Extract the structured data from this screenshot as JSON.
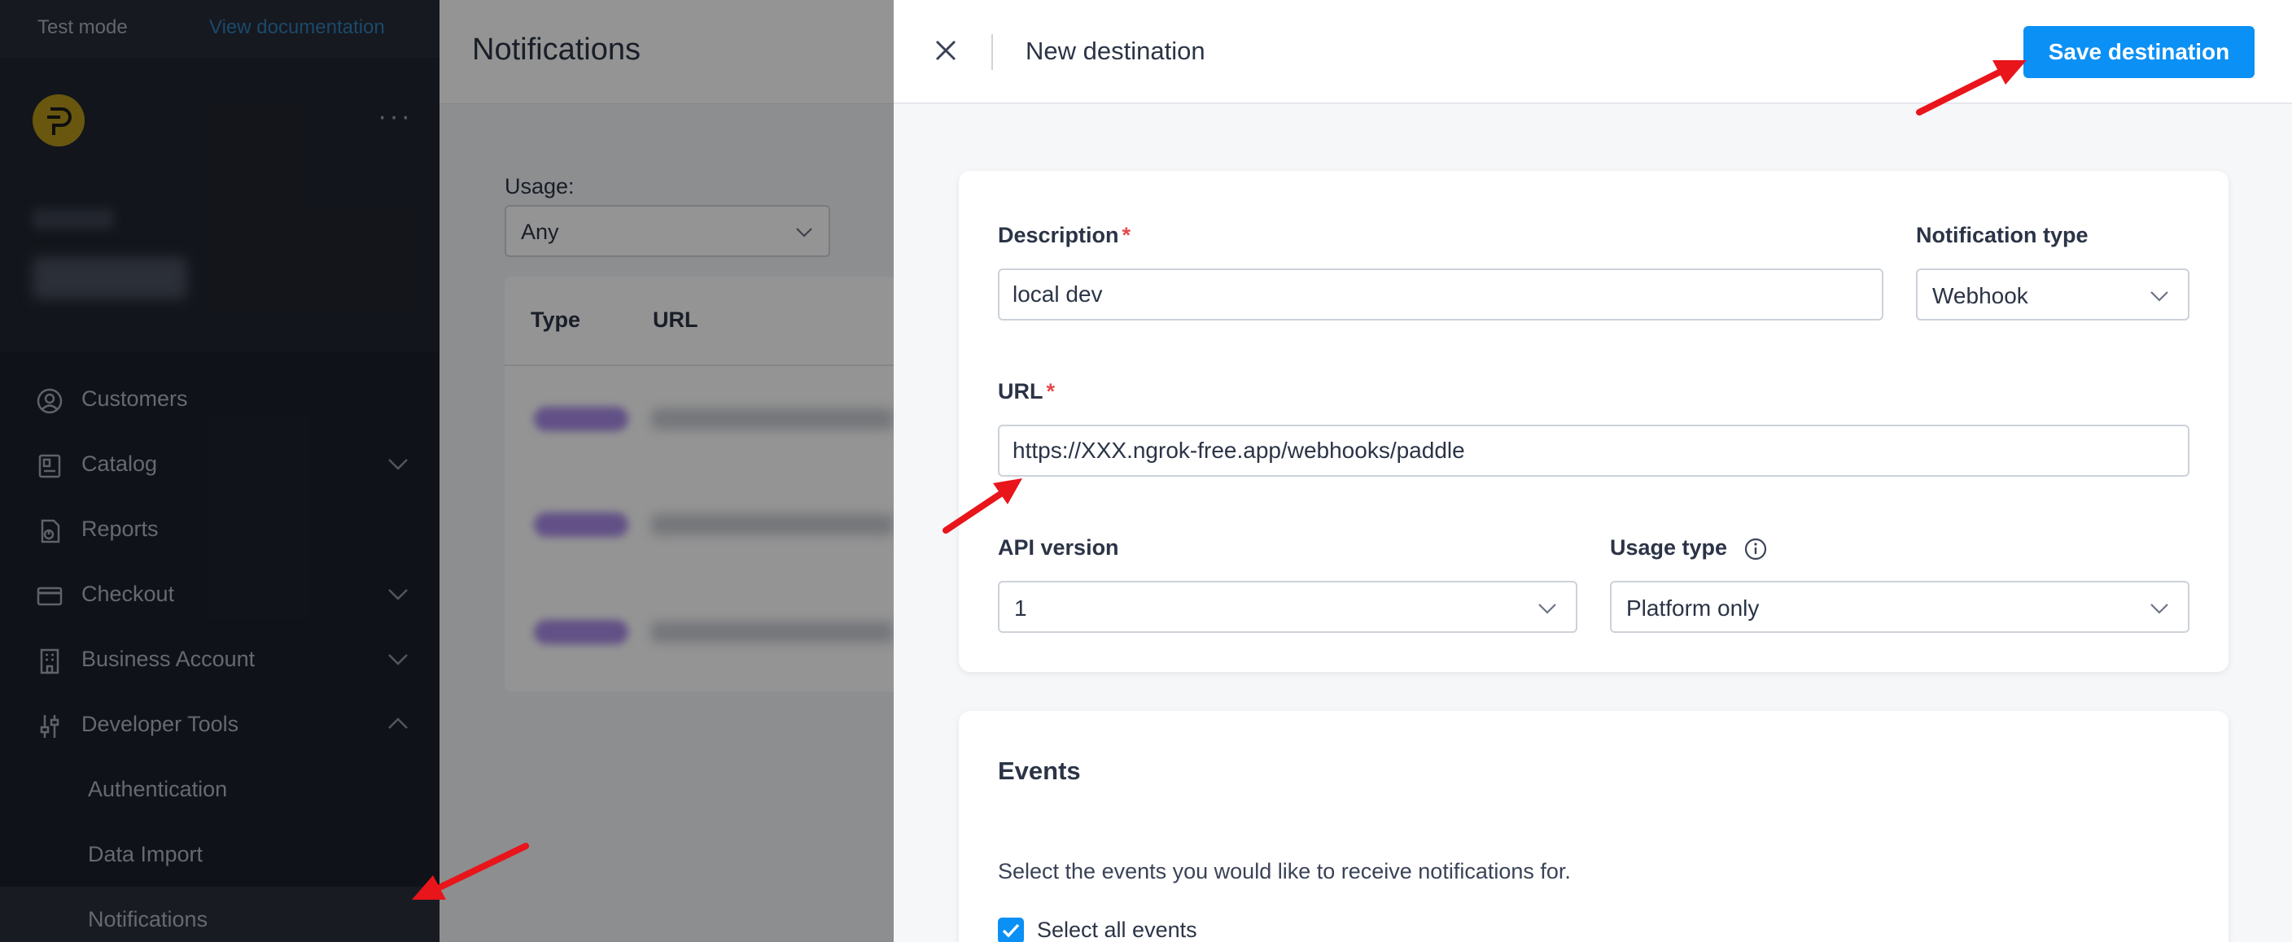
{
  "topbar": {
    "mode": "Test mode",
    "docs_link": "View documentation"
  },
  "sidebar": {
    "items": [
      {
        "label": "Customers",
        "icon": "user-circle-icon"
      },
      {
        "label": "Catalog",
        "icon": "catalog-icon"
      },
      {
        "label": "Reports",
        "icon": "reports-icon"
      },
      {
        "label": "Checkout",
        "icon": "credit-card-icon"
      },
      {
        "label": "Business Account",
        "icon": "building-icon"
      },
      {
        "label": "Developer Tools",
        "icon": "sliders-icon"
      }
    ],
    "sub_items": [
      "Authentication",
      "Data Import",
      "Notifications"
    ],
    "active": "Notifications"
  },
  "background": {
    "title": "Notifications",
    "usage_label": "Usage:",
    "usage_value": "Any",
    "columns": [
      "Type",
      "URL"
    ]
  },
  "drawer": {
    "title": "New destination",
    "save_label": "Save destination",
    "description_label": "Description",
    "description_value": "local dev",
    "notification_type_label": "Notification type",
    "notification_type_value": "Webhook",
    "url_label": "URL",
    "url_value": "https://XXX.ngrok-free.app/webhooks/paddle",
    "api_version_label": "API version",
    "api_version_value": "1",
    "usage_type_label": "Usage type",
    "usage_type_value": "Platform only",
    "events_title": "Events",
    "events_description": "Select the events you would like to receive notifications for.",
    "select_all_label": "Select all events",
    "select_all_checked": true
  },
  "colors": {
    "accent": "#0b90f5",
    "sidebar_bg": "#1b202b",
    "annotation_arrow": "#e8151b",
    "required": "#e5484d"
  }
}
